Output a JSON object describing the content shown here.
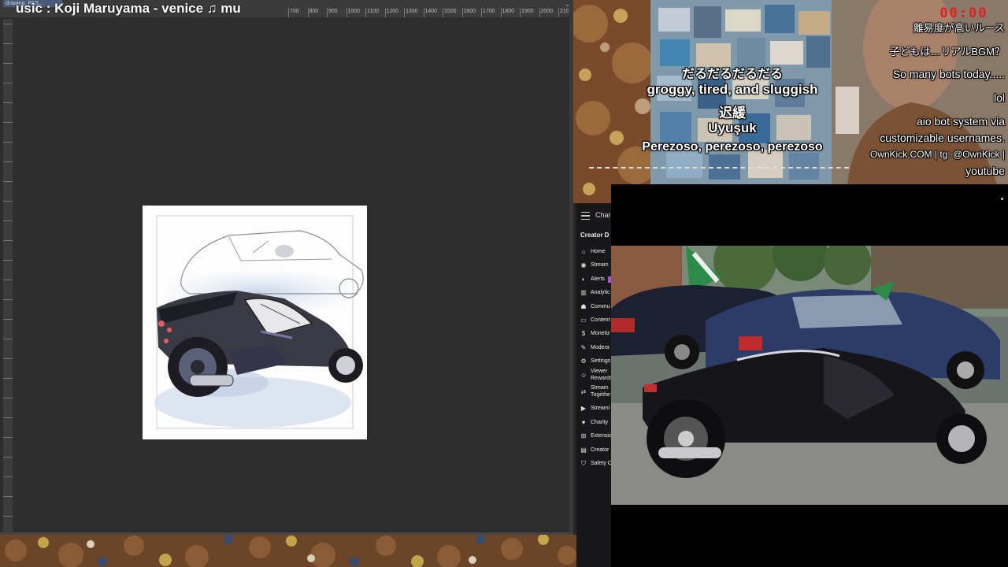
{
  "app": {
    "doc_tab": "drawing_PAS...",
    "now_playing": "usic : Koji Maruyama - venice         ♫ mu",
    "ruler_labels": [
      "700",
      "800",
      "900",
      "1000",
      "1100",
      "1200",
      "1300",
      "1400",
      "1500",
      "1600",
      "1700",
      "1800",
      "1900",
      "2000",
      "2100"
    ]
  },
  "captions": {
    "left": [
      "だるだるだるだる",
      "groggy, tired, and sluggish",
      "迟緩",
      "Uyuşuk",
      "Perezoso, perezoso, perezoso"
    ],
    "right": [
      "離易度が高いルース",
      "子どもは…リアルBGM？",
      "So many bots today.....",
      "lol",
      "aio bot system via",
      "customizable usernames.",
      "OwnKick.COM | tg: @OwnKick |",
      "youtube"
    ],
    "timer": "00:00"
  },
  "dashboard": {
    "channel": "Char",
    "section": "Creator D",
    "items": [
      {
        "icon": "home-icon",
        "glyph": "⌂",
        "label": "Home"
      },
      {
        "icon": "stream-icon",
        "glyph": "◉",
        "label": "Stream"
      },
      {
        "icon": "alerts-icon",
        "glyph": "◐",
        "label": "Alerts"
      },
      {
        "icon": "analytics-icon",
        "glyph": "▥",
        "label": "Analytic"
      },
      {
        "icon": "community-icon",
        "glyph": "☗",
        "label": "Commu"
      },
      {
        "icon": "content-icon",
        "glyph": "▭",
        "label": "Content"
      },
      {
        "icon": "monetization-icon",
        "glyph": "$",
        "label": "Monetiz"
      },
      {
        "icon": "moderation-icon",
        "glyph": "✎",
        "label": "Modera"
      },
      {
        "icon": "settings-icon",
        "glyph": "⚙",
        "label": "Settings"
      },
      {
        "icon": "viewer-rewards-icon",
        "glyph": "☺",
        "label": "Viewer\nRewards"
      },
      {
        "icon": "stream-together-icon",
        "glyph": "⇄",
        "label": "Stream\nTogethe"
      },
      {
        "icon": "streaming-tools-icon",
        "glyph": "▶",
        "label": "Streami"
      },
      {
        "icon": "charity-icon",
        "glyph": "♥",
        "label": "Charity"
      },
      {
        "icon": "extensions-icon",
        "glyph": "⊞",
        "label": "Extensio"
      },
      {
        "icon": "creator-camp-icon",
        "glyph": "▤",
        "label": "Creator"
      },
      {
        "icon": "safety-center-icon",
        "glyph": "⛉",
        "label": "Safety C"
      }
    ]
  },
  "colors": {
    "app_bg": "#2d2d2d",
    "dashboard_bg": "#18181b",
    "timer": "#e02020",
    "badge": "#b04ee0"
  }
}
